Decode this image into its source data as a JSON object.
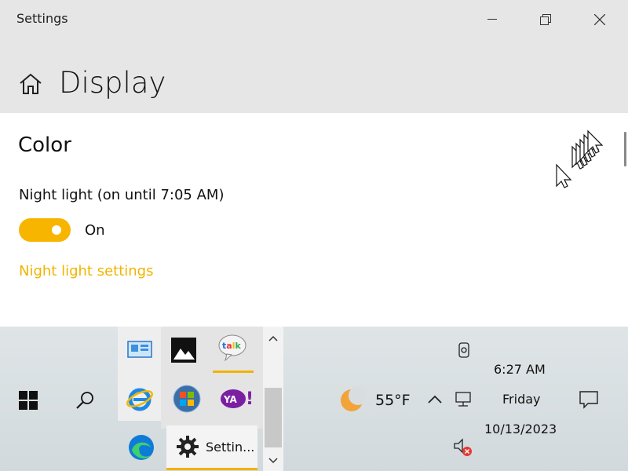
{
  "window": {
    "title": "Settings",
    "page_title": "Display"
  },
  "content": {
    "section_title": "Color",
    "night_light_label": "Night light (on until 7:05 AM)",
    "toggle_state": "On",
    "night_light_link": "Night light settings"
  },
  "colors": {
    "accent": "#f7b500",
    "link": "#f0b400"
  },
  "taskbar": {
    "weather_temp": "55°F",
    "settings_app_label": "Settin...",
    "time": "6:27 AM",
    "day": "Friday",
    "date": "10/13/2023"
  },
  "icons": {
    "start": "windows-logo-icon",
    "search": "search-icon",
    "home": "home-icon"
  }
}
